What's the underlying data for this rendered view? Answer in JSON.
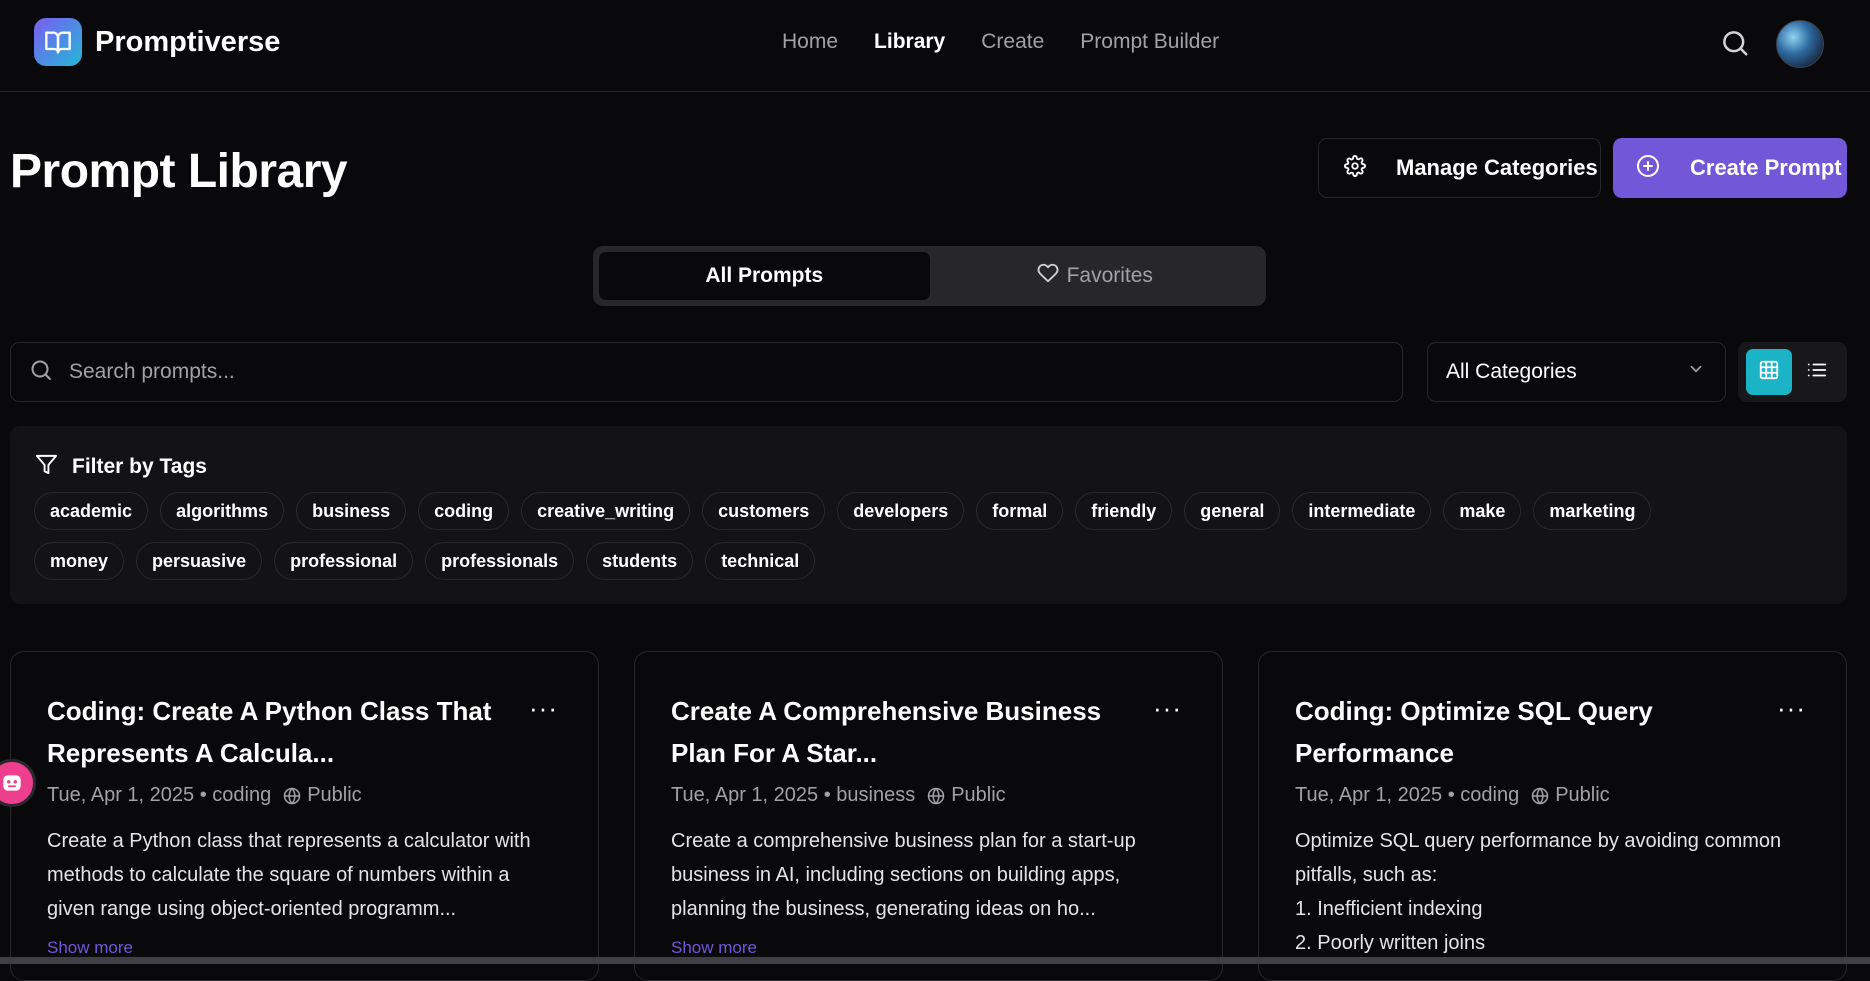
{
  "nav": {
    "brand": "Promptiverse",
    "links": [
      "Home",
      "Library",
      "Create",
      "Prompt Builder"
    ],
    "active": "Library",
    "icons": {
      "logo": "book-open-icon",
      "search": "search-icon",
      "avatar": "user-avatar"
    }
  },
  "header": {
    "title": "Prompt Library",
    "manage_label": "Manage Categories",
    "create_label": "Create Prompt"
  },
  "tabs": {
    "all": "All Prompts",
    "favorites": "Favorites",
    "active": "All Prompts"
  },
  "search": {
    "placeholder": "Search prompts...",
    "value": ""
  },
  "category_select": {
    "value": "All Categories"
  },
  "view_mode": "grid",
  "filter": {
    "title": "Filter by Tags",
    "tags": [
      "academic",
      "algorithms",
      "business",
      "coding",
      "creative_writing",
      "customers",
      "developers",
      "formal",
      "friendly",
      "general",
      "intermediate",
      "make",
      "marketing",
      "money",
      "persuasive",
      "professional",
      "professionals",
      "students",
      "technical"
    ]
  },
  "cards": [
    {
      "title": "Coding: Create A Python Class That Represents A Calcula...",
      "date": "Tue, Apr 1, 2025",
      "category": "coding",
      "visibility": "Public",
      "desc": [
        "Create a Python class that represents a calculator with",
        "methods to calculate the square of numbers within a",
        "given range using object-oriented programm..."
      ],
      "more": "Show more"
    },
    {
      "title": "Create A Comprehensive Business Plan For A Star...",
      "date": "Tue, Apr 1, 2025",
      "category": "business",
      "visibility": "Public",
      "desc": [
        "Create a comprehensive business plan for a start-up",
        "business in AI, including sections on building apps,",
        "planning the business, generating ideas on ho..."
      ],
      "more": "Show more"
    },
    {
      "title": "Coding: Optimize SQL Query Performance",
      "date": "Tue, Apr 1, 2025",
      "category": "coding",
      "visibility": "Public",
      "desc": [
        "Optimize SQL query performance by avoiding common",
        "pitfalls, such as:",
        "1. Inefficient indexing",
        "2. Poorly written joins"
      ],
      "more": ""
    }
  ],
  "colors": {
    "accent": "#7357d9",
    "view_active": "#1bb4c7",
    "background": "#09090b"
  }
}
